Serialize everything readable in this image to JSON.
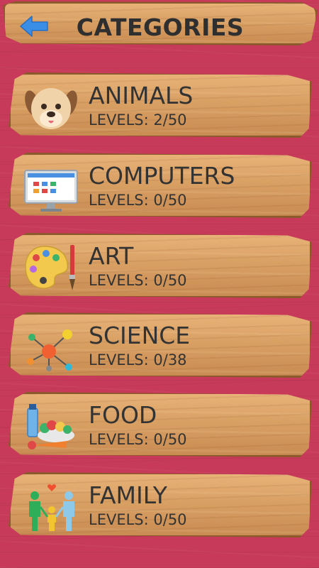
{
  "header": {
    "title": "CATEGORIES",
    "back_icon": "back-arrow-icon"
  },
  "categories": [
    {
      "name": "ANIMALS",
      "levels": "LEVELS: 2/50",
      "icon": "dog-icon"
    },
    {
      "name": "COMPUTERS",
      "levels": "LEVELS: 0/50",
      "icon": "monitor-icon"
    },
    {
      "name": "ART",
      "levels": "LEVELS: 0/50",
      "icon": "palette-icon"
    },
    {
      "name": "SCIENCE",
      "levels": "LEVELS: 0/38",
      "icon": "molecule-icon"
    },
    {
      "name": "FOOD",
      "levels": "LEVELS: 0/50",
      "icon": "food-icon"
    },
    {
      "name": "FAMILY",
      "levels": "LEVELS: 0/50",
      "icon": "family-icon"
    }
  ],
  "colors": {
    "background": "#c83a5a",
    "plank": "#d9a064",
    "text": "#333333",
    "back_arrow": "#3a8ee6"
  }
}
